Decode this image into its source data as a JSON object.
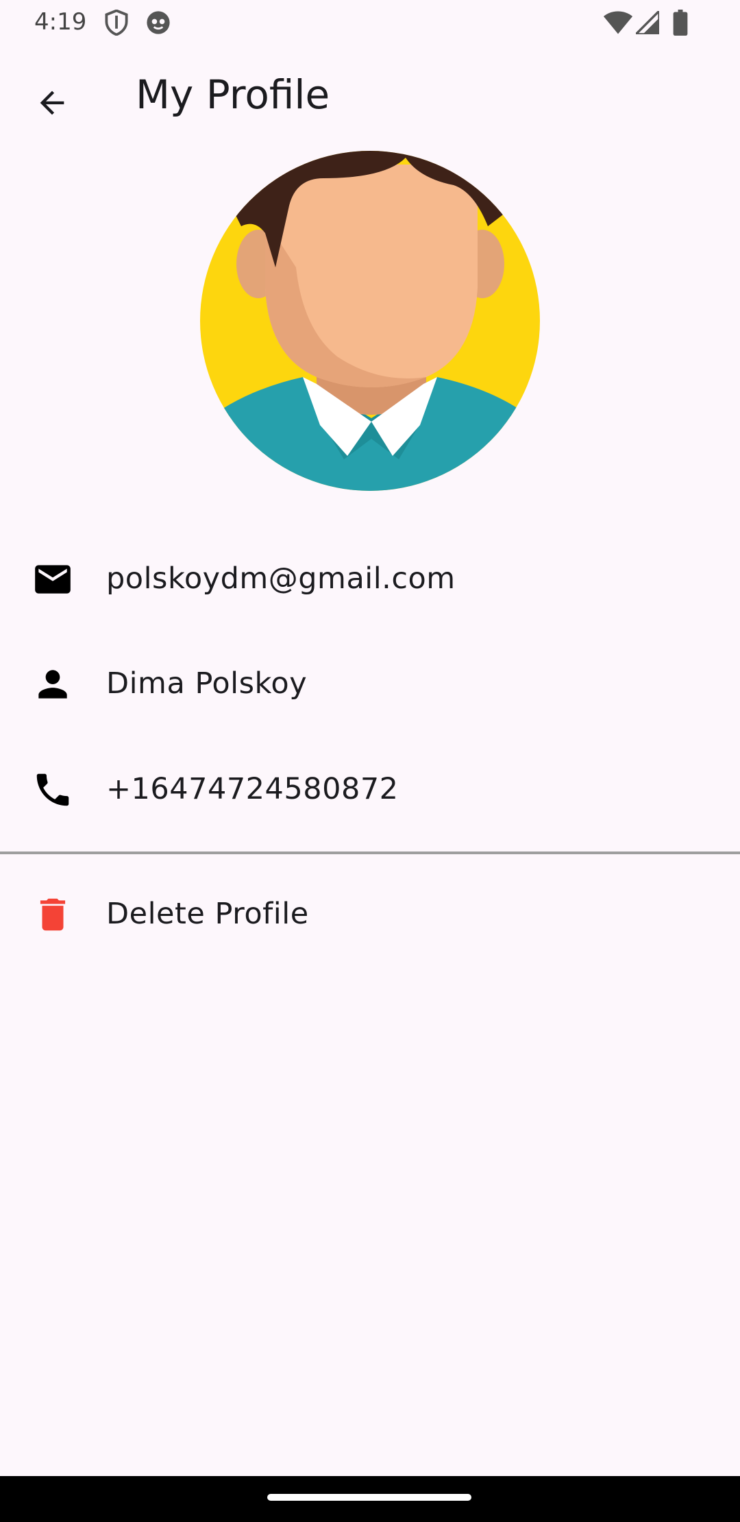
{
  "status_bar": {
    "time": "4:19",
    "icons": [
      "shield-icon",
      "robot-face-icon",
      "wifi-icon",
      "cellular-signal-icon",
      "battery-icon"
    ]
  },
  "app_bar": {
    "back_icon": "arrow-left-icon",
    "title": "My Profile"
  },
  "avatar": {
    "alt": "Profile avatar illustration"
  },
  "profile": {
    "email": {
      "icon": "mail-icon",
      "value": "polskoydm@gmail.com"
    },
    "name": {
      "icon": "person-icon",
      "value": "Dima Polskoy"
    },
    "phone": {
      "icon": "phone-icon",
      "value": "+16474724580872"
    }
  },
  "actions": {
    "delete": {
      "icon": "trash-icon",
      "label": "Delete Profile",
      "color": "#F44336"
    }
  },
  "colors": {
    "background": "#FDF7FC",
    "divider": "#9E9E9E",
    "avatar_bg": "#FDD60E",
    "shirt": "#2AA0AC"
  }
}
